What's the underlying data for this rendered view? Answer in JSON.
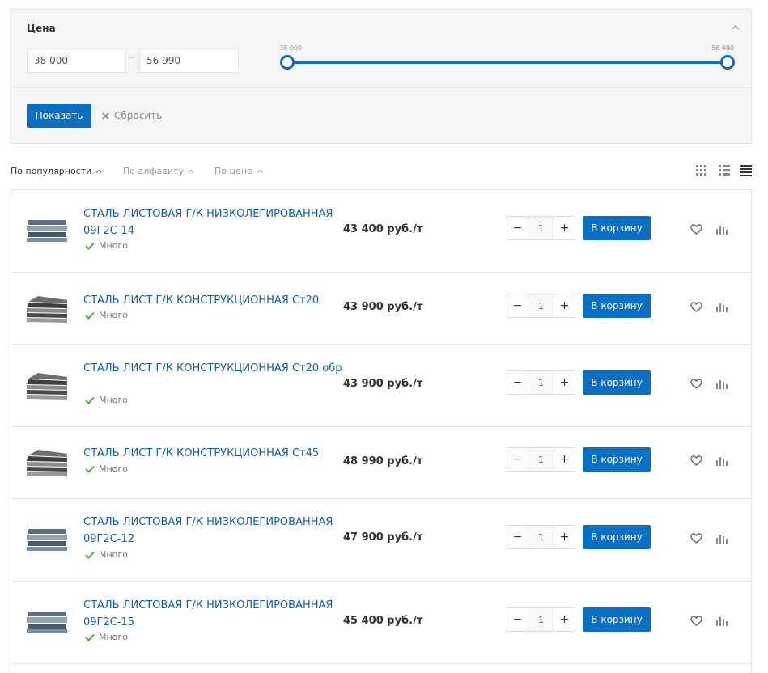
{
  "filter": {
    "title": "Цена",
    "min_value": "38 000",
    "max_value": "56 990",
    "slider_min_label": "38 000",
    "slider_max_label": "56 990",
    "show_label": "Показать",
    "reset_label": "Сбросить",
    "range_fraction": [
      0,
      1
    ]
  },
  "sort": {
    "items": [
      {
        "label": "По популярности",
        "active": true
      },
      {
        "label": "По алфавиту",
        "active": false
      },
      {
        "label": "По цене",
        "active": false
      }
    ]
  },
  "products": [
    {
      "name": "СТАЛЬ ЛИСТОВАЯ Г/К НИЗКОЛЕГИРОВАННАЯ 09Г2С-14",
      "stock": "Много",
      "price": "43 400 руб./т",
      "qty": "1",
      "cart_label": "В корзину"
    },
    {
      "name": "СТАЛЬ ЛИСТ Г/К КОНСТРУКЦИОННАЯ Ст20",
      "stock": "Много",
      "price": "43 900 руб./т",
      "qty": "1",
      "cart_label": "В корзину"
    },
    {
      "name": "СТАЛЬ ЛИСТ Г/К КОНСТРУКЦИОННАЯ Ст20 обр",
      "stock": "Много",
      "price": "43 900 руб./т",
      "qty": "1",
      "cart_label": "В корзину"
    },
    {
      "name": "СТАЛЬ ЛИСТ Г/К КОНСТРУКЦИОННАЯ Ст45",
      "stock": "Много",
      "price": "48 990 руб./т",
      "qty": "1",
      "cart_label": "В корзину"
    },
    {
      "name": "СТАЛЬ ЛИСТОВАЯ Г/К НИЗКОЛЕГИРОВАННАЯ 09Г2С-12",
      "stock": "Много",
      "price": "47 900 руб./т",
      "qty": "1",
      "cart_label": "В корзину"
    },
    {
      "name": "СТАЛЬ ЛИСТОВАЯ Г/К НИЗКОЛЕГИРОВАННАЯ 09Г2С-15",
      "stock": "Много",
      "price": "45 400 руб./т",
      "qty": "1",
      "cart_label": "В корзину"
    }
  ],
  "colors": {
    "accent": "#0b6fc1",
    "link": "#1060a8",
    "in_stock": "#4caf3a"
  },
  "icons": {
    "collapse": "chevron-up-icon",
    "reset": "close-icon",
    "view_tiles": "grid-view-icon",
    "view_list": "list-view-icon",
    "view_table": "table-view-icon",
    "stock": "check-icon",
    "favorite": "heart-icon",
    "compare": "bar-chart-icon"
  }
}
